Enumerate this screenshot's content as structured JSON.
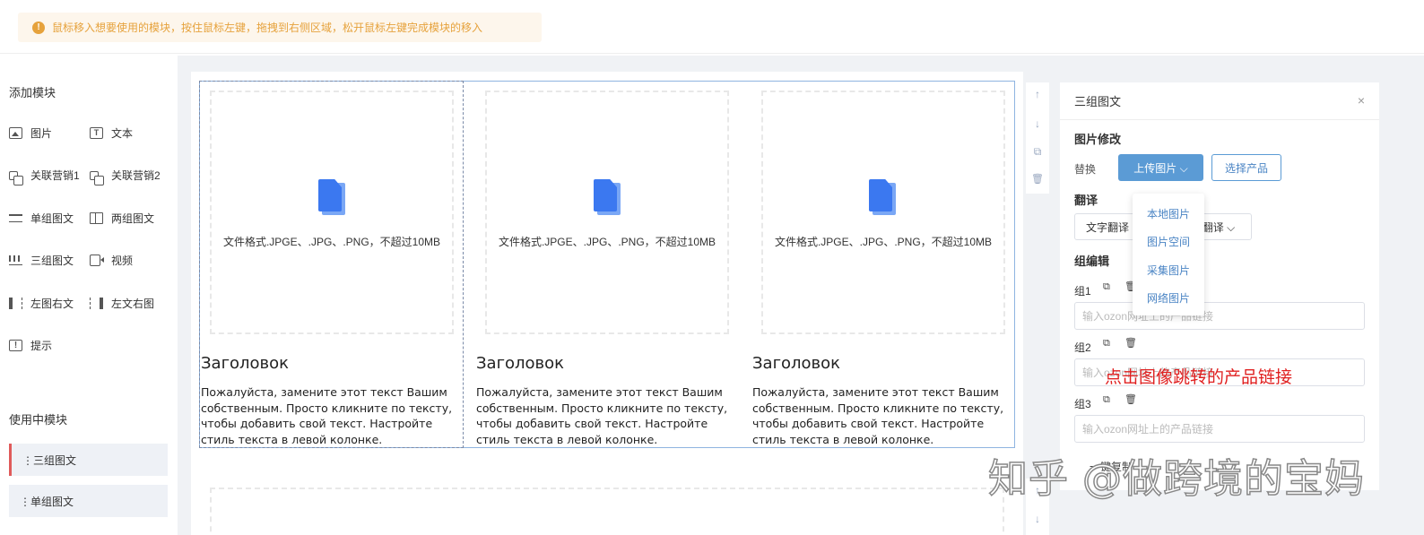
{
  "notice": {
    "icon": "warning-icon",
    "text": "鼠标移入想要使用的模块，按住鼠标左键，拖拽到右侧区域，松开鼠标左键完成模块的移入"
  },
  "sidebar": {
    "add_title": "添加模块",
    "modules": [
      {
        "label": "图片",
        "icon": "image-icon"
      },
      {
        "label": "文本",
        "icon": "text-icon"
      },
      {
        "label": "关联营销1",
        "icon": "link-icon"
      },
      {
        "label": "关联营销2",
        "icon": "link-icon"
      },
      {
        "label": "单组图文",
        "icon": "single-group-icon"
      },
      {
        "label": "两组图文",
        "icon": "double-group-icon"
      },
      {
        "label": "三组图文",
        "icon": "triple-group-icon"
      },
      {
        "label": "视频",
        "icon": "video-icon"
      },
      {
        "label": "左图右文",
        "icon": "left-image-icon"
      },
      {
        "label": "左文右图",
        "icon": "right-image-icon"
      },
      {
        "label": "提示",
        "icon": "tip-icon"
      }
    ],
    "inuse_title": "使用中模块",
    "inuse": [
      {
        "label": "⋮三组图文",
        "active": true
      },
      {
        "label": "⋮单组图文",
        "active": false
      }
    ]
  },
  "block": {
    "columns": [
      {
        "file_hint": "文件格式.JPGE、.JPG、.PNG，不超过10MB",
        "heading": "Заголовок",
        "text": "Пожалуйста, замените этот текст Вашим собственным. Просто кликните по тексту, чтобы добавить свой текст. Настройте стиль текста в левой колонке."
      },
      {
        "file_hint": "文件格式.JPGE、.JPG、.PNG，不超过10MB",
        "heading": "Заголовок",
        "text": "Пожалуйста, замените этот текст Вашим собственным. Просто кликните по тексту, чтобы добавить свой текст. Настройте стиль текста в левой колонке."
      },
      {
        "file_hint": "文件格式.JPGE、.JPG、.PNG，不超过10MB",
        "heading": "Заголовок",
        "text": "Пожалуйста, замените этот текст Вашим собственным. Просто кликните по тексту, чтобы добавить свой текст. Настройте стиль текста в левой колонке."
      }
    ]
  },
  "tools": {
    "up": "↑",
    "down": "↓",
    "copy": "⧉",
    "delete": "🗑"
  },
  "panel": {
    "title": "三组图文",
    "close": "×",
    "image_section": "图片修改",
    "replace_label": "替换",
    "upload_btn": "上传图片 ⌵",
    "select_product_btn": "选择产品",
    "translate_section": "翻译",
    "text_translate_btn": "文字翻译",
    "image_translate_btn": "翻译 ⌵",
    "group_section": "组编辑",
    "groups": [
      {
        "label": "组1",
        "placeholder": "输入ozon网址上的产品链接"
      },
      {
        "label": "组2",
        "placeholder": "输入ozon网址上的产品链接"
      },
      {
        "label": "组3",
        "placeholder": "输入ozon网址上的产品链接"
      }
    ],
    "partial_btn": "一键复制"
  },
  "dropdown": [
    "本地图片",
    "图片空间",
    "采集图片",
    "网络图片"
  ],
  "annotation": "点击图像跳转的产品链接",
  "watermark": "知乎 @做跨境的宝妈",
  "colors": {
    "accent": "#5b9bd5",
    "warning": "#e6a23c",
    "red": "#e02020"
  }
}
